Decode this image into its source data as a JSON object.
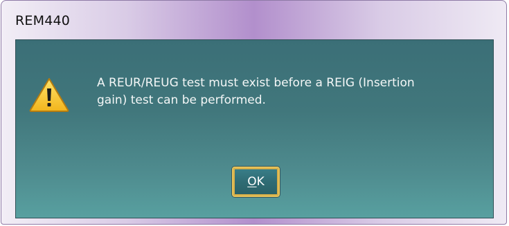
{
  "window": {
    "title": "REM440"
  },
  "dialog": {
    "icon": "warning-icon",
    "message_lines": [
      "A REUR/REUG test must exist before a REIG (Insertion",
      "gain) test can be performed."
    ],
    "ok_button": {
      "label": "OK",
      "mnemonic": "O",
      "rest": "K"
    }
  },
  "colors": {
    "client_background": "#41777c",
    "titlebar_accent": "#b28fcc",
    "button_focus_border": "#e6c35a"
  }
}
